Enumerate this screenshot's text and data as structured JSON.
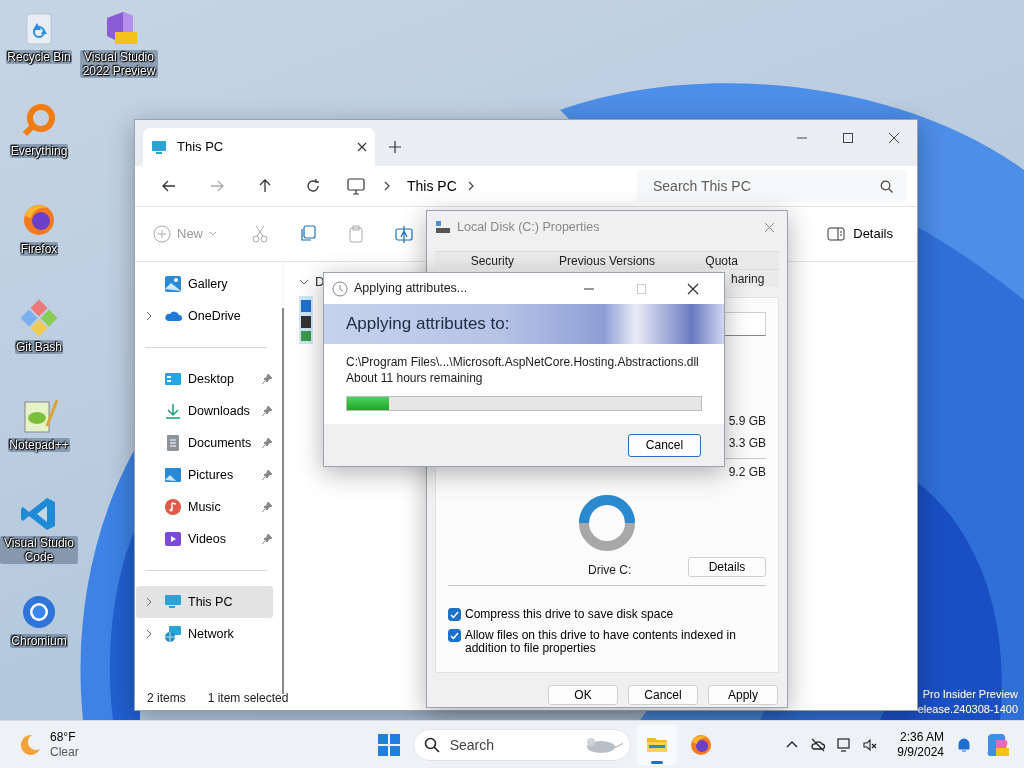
{
  "desktop": {
    "icons": [
      {
        "label": "Recycle Bin"
      },
      {
        "label": "Visual Studio 2022 Preview"
      },
      {
        "label": "Everything"
      },
      {
        "label": "Firefox"
      },
      {
        "label": "Git Bash"
      },
      {
        "label": "Notepad++"
      },
      {
        "label": "Visual Studio Code"
      },
      {
        "label": "Chromium"
      }
    ],
    "watermark": [
      "Pro Insider Preview",
      "elease.240308-1400"
    ]
  },
  "explorer": {
    "tabs": [
      {
        "title": "This PC",
        "selected": true
      }
    ],
    "breadcrumb": [
      "This PC"
    ],
    "search": {
      "placeholder": "Search This PC"
    },
    "toolbar": {
      "new_label": "New",
      "details_label": "Details"
    },
    "sections": [
      {
        "items": [
          {
            "label": "Gallery",
            "expandable": false,
            "pinned": false,
            "selected": false
          },
          {
            "label": "OneDrive",
            "expandable": true,
            "pinned": false,
            "selected": false
          }
        ]
      },
      {
        "items": [
          {
            "label": "Desktop",
            "expandable": false,
            "pinned": true,
            "selected": false
          },
          {
            "label": "Downloads",
            "expandable": false,
            "pinned": true,
            "selected": false
          },
          {
            "label": "Documents",
            "expandable": false,
            "pinned": true,
            "selected": false
          },
          {
            "label": "Pictures",
            "expandable": false,
            "pinned": true,
            "selected": false
          },
          {
            "label": "Music",
            "expandable": false,
            "pinned": true,
            "selected": false
          },
          {
            "label": "Videos",
            "expandable": false,
            "pinned": true,
            "selected": false
          }
        ]
      },
      {
        "items": [
          {
            "label": "This PC",
            "expandable": true,
            "pinned": false,
            "selected": true
          },
          {
            "label": "Network",
            "expandable": true,
            "pinned": false,
            "selected": false
          }
        ]
      }
    ],
    "content_header": "D",
    "status": [
      "2 items",
      "1 item selected"
    ]
  },
  "properties": {
    "title": "Local Disk (C:) Properties",
    "tabs_row1": [
      {
        "label": "Security",
        "selected": false
      },
      {
        "label": "Previous Versions",
        "selected": false
      },
      {
        "label": "Quota",
        "selected": false
      }
    ],
    "tabs_row2": [
      {
        "label": "haring",
        "selected": false
      }
    ],
    "sizes": [
      "5.9 GB",
      "3.3 GB",
      "9.2 GB"
    ],
    "drive_label": "Drive C:",
    "details_button": "Details",
    "checkboxes": [
      {
        "label": "Compress this drive to save disk space",
        "checked": true
      },
      {
        "label": "Allow files on this drive to have contents indexed in addition to file properties",
        "checked": true
      }
    ],
    "buttons": [
      "OK",
      "Cancel",
      "Apply"
    ]
  },
  "progress": {
    "title": "Applying attributes...",
    "heading": "Applying attributes to:",
    "path": "C:\\Program Files\\...\\Microsoft.AspNetCore.Hosting.Abstractions.dll",
    "remaining": "About 11 hours remaining",
    "level": 0.12,
    "button": "Cancel"
  },
  "taskbar": {
    "weather": {
      "temperature": "68°F",
      "condition": "Clear"
    },
    "search": {
      "placeholder": "Search"
    },
    "apps": [
      {
        "kind": "file-explorer",
        "selected": true
      },
      {
        "kind": "firefox",
        "selected": false
      }
    ],
    "clock": {
      "time": "2:36 AM",
      "date": "9/9/2024"
    }
  }
}
